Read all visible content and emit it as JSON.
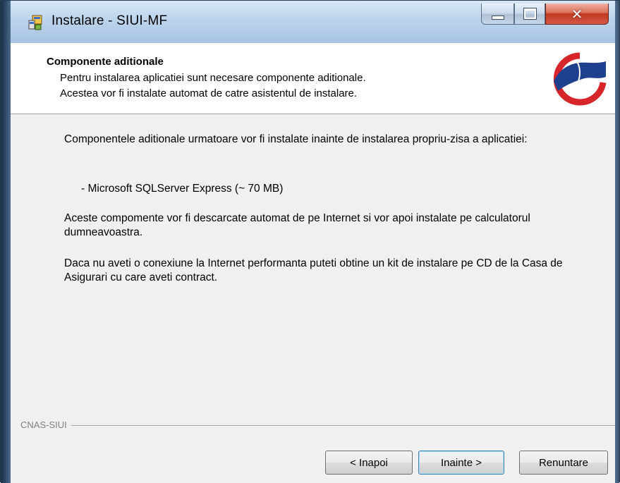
{
  "window": {
    "title": "Instalare - SIUI-MF",
    "controls": {
      "minimize": "minimize-icon",
      "maximize": "maximize-icon",
      "close": "close-icon"
    }
  },
  "header": {
    "title": "Componente aditionale",
    "line1": "Pentru instalarea aplicatiei sunt necesare componente aditionale.",
    "line2": "Acestea vor fi instalate automat de catre asistentul de instalare.",
    "logo": "cnas-logo"
  },
  "body": {
    "paragraph1": "Componentele aditionale urmatoare vor fi instalate inainte de instalarea propriu-zisa a aplicatiei:",
    "item1": "- Microsoft SQLServer Express (~ 70 MB)",
    "paragraph2": "Aceste compomente vor fi descarcate automat de pe Internet si vor apoi instalate pe calculatorul dumneavoastra.",
    "paragraph3": "Daca nu aveti o conexiune la Internet performanta puteti obtine un kit de instalare pe CD de la Casa de Asigurari cu care aveti contract."
  },
  "footer": {
    "group_label": "CNAS-SIUI",
    "back_label": "< Inapoi",
    "next_label": "Inainte >",
    "cancel_label": "Renuntare"
  },
  "colors": {
    "title_bar": "#bcd4ec",
    "close_button": "#c0391f",
    "logo_blue": "#1f3f8f",
    "logo_red": "#d7262a",
    "default_button_border": "#3c7fb1"
  }
}
